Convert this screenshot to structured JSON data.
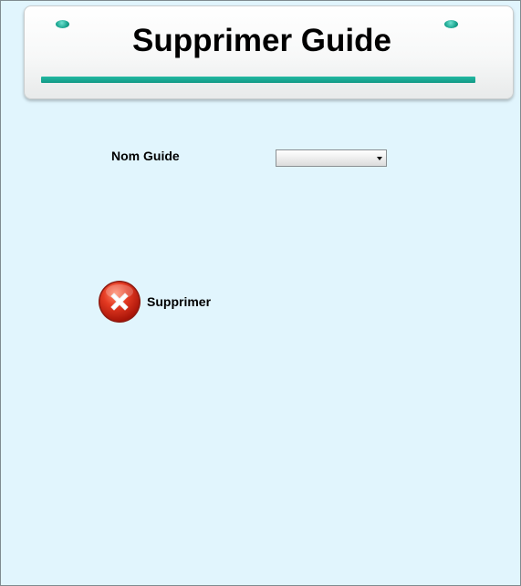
{
  "header": {
    "title": "Supprimer Guide"
  },
  "form": {
    "guide_label": "Nom Guide",
    "guide_select_value": ""
  },
  "actions": {
    "delete_label": "Supprimer"
  },
  "colors": {
    "background": "#e1f5fd",
    "accent": "#19a58f",
    "delete_icon": "#d4281c"
  },
  "icons": {
    "delete": "close-circle-icon"
  }
}
